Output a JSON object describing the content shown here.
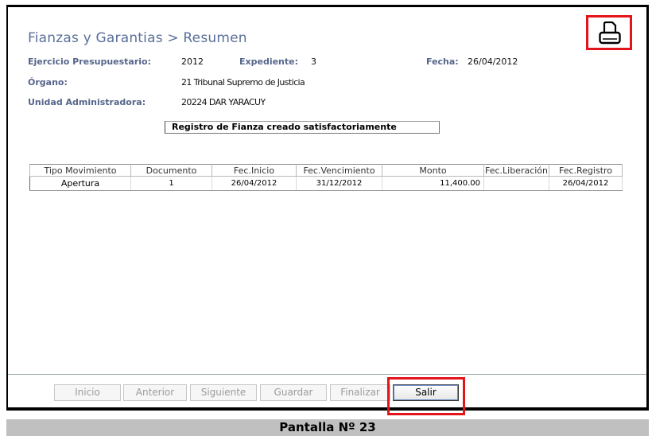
{
  "title": "Fianzas y Garantias > Resumen",
  "fields": {
    "ejercicio_label": "Ejercicio Presupuestario:",
    "ejercicio_value": "2012",
    "expediente_label": "Expediente:",
    "expediente_value": "3",
    "fecha_label": "Fecha:",
    "fecha_value": "26/04/2012",
    "organo_label": "Órgano:",
    "organo_value": "21 Tribunal Supremo de Justicia",
    "unidad_label": "Unidad Administradora:",
    "unidad_value": "20224 DAR YARACUY"
  },
  "message": "Registro de Fianza creado satisfactoriamente",
  "table": {
    "headers": [
      "Tipo Movimiento",
      "Documento",
      "Fec.Inicio",
      "Fec.Vencimiento",
      "Monto",
      "Fec.Liberación",
      "Fec.Registro"
    ],
    "rows": [
      [
        "Apertura",
        "1",
        "26/04/2012",
        "31/12/2012",
        "11,400.00",
        "",
        "26/04/2012"
      ]
    ]
  },
  "buttons": {
    "inicio": "Inicio",
    "anterior": "Anterior",
    "siguiente": "Siguiente",
    "guardar": "Guardar",
    "finalizar": "Finalizar",
    "salir": "Salir"
  },
  "caption": "Pantalla Nº 23",
  "icons": {
    "print": "printer-icon"
  },
  "colors": {
    "title": "#5a6f9a",
    "label": "#55658a",
    "highlight": "#e4141b",
    "caption_bg": "#c0c0c0"
  }
}
